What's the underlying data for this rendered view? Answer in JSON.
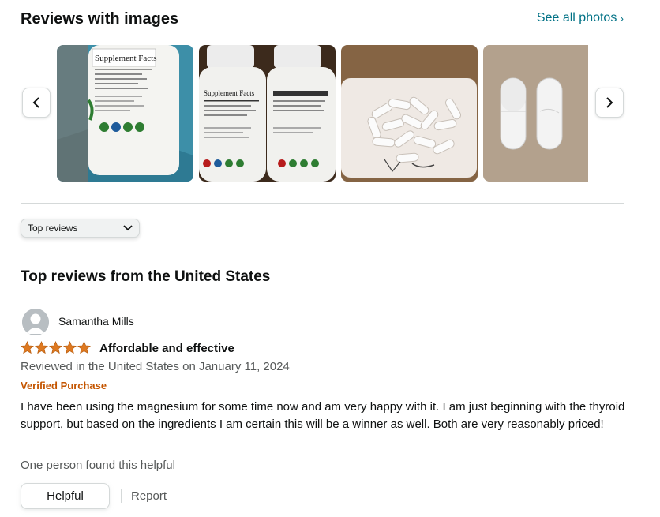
{
  "images_section": {
    "title": "Reviews with images",
    "see_all_label": "See all photos",
    "see_all_chevron": "›",
    "prev_icon": "chevron-left-icon",
    "next_icon": "chevron-right-icon"
  },
  "sort": {
    "selected": "Top reviews",
    "icon": "chevron-down-icon"
  },
  "reviews_heading": "Top reviews from the United States",
  "review": {
    "reviewer": "Samantha Mills",
    "avatar_icon": "user-avatar-icon",
    "rating": 5,
    "rating_max": 5,
    "title": "Affordable and effective",
    "date_text": "Reviewed in the United States on January 11, 2024",
    "verified_label": "Verified Purchase",
    "body": "I have been using the magnesium for some time now and am very happy with it. I am just beginning with the thyroid support, but based on the ingredients I am certain this will be a winner as well. Both are very reasonably priced!",
    "helpful_count_text": "One person found this helpful",
    "helpful_button": "Helpful",
    "report_label": "Report"
  },
  "colors": {
    "link": "#007185",
    "verified": "#c45500",
    "star": "#de7921",
    "muted_text": "#565959",
    "text": "#0f1111"
  }
}
